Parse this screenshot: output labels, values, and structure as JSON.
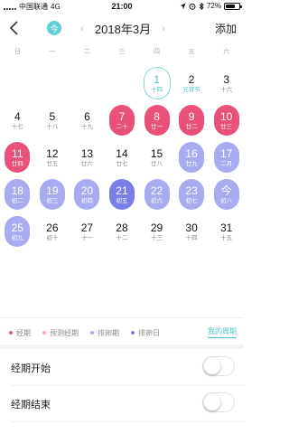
{
  "status_bar": {
    "carrier": "中国联通",
    "network": "4G",
    "time": "21:00",
    "battery": "72%",
    "battery_level": 0.72
  },
  "header": {
    "today_label": "今",
    "month_title": "2018年3月",
    "prev_icon": "chevron-left-icon",
    "next_icon": "chevron-right-icon",
    "add_label": "添加"
  },
  "weekdays": [
    "日",
    "一",
    "二",
    "三",
    "四",
    "五",
    "六"
  ],
  "calendar": {
    "weeks": [
      [
        null,
        null,
        null,
        null,
        {
          "day": "1",
          "sub": "十四",
          "type": "today"
        },
        {
          "day": "2",
          "sub": "元宵节",
          "type": "festival"
        },
        {
          "day": "3",
          "sub": "十六",
          "type": "normal"
        }
      ],
      [
        {
          "day": "4",
          "sub": "十七",
          "type": "normal"
        },
        {
          "day": "5",
          "sub": "十八",
          "type": "normal"
        },
        {
          "day": "6",
          "sub": "十九",
          "type": "normal"
        },
        {
          "day": "7",
          "sub": "二十",
          "type": "period"
        },
        {
          "day": "8",
          "sub": "廿一",
          "type": "period"
        },
        {
          "day": "9",
          "sub": "廿二",
          "type": "period"
        },
        {
          "day": "10",
          "sub": "廿三",
          "type": "period"
        }
      ],
      [
        {
          "day": "11",
          "sub": "廿四",
          "type": "period"
        },
        {
          "day": "12",
          "sub": "廿五",
          "type": "normal"
        },
        {
          "day": "13",
          "sub": "廿六",
          "type": "normal"
        },
        {
          "day": "14",
          "sub": "廿七",
          "type": "normal"
        },
        {
          "day": "15",
          "sub": "廿八",
          "type": "normal"
        },
        {
          "day": "16",
          "sub": "廿九",
          "type": "ovulation"
        },
        {
          "day": "17",
          "sub": "二月",
          "type": "ovulation"
        }
      ],
      [
        {
          "day": "18",
          "sub": "初二",
          "type": "ovulation"
        },
        {
          "day": "19",
          "sub": "初三",
          "type": "ovulation"
        },
        {
          "day": "20",
          "sub": "初四",
          "type": "ovulation"
        },
        {
          "day": "21",
          "sub": "初五",
          "type": "ovulation-day"
        },
        {
          "day": "22",
          "sub": "初六",
          "type": "ovulation"
        },
        {
          "day": "23",
          "sub": "初七",
          "type": "ovulation"
        },
        {
          "day": "今",
          "sub": "初八",
          "type": "ovulation"
        }
      ],
      [
        {
          "day": "25",
          "sub": "初九",
          "type": "ovulation"
        },
        {
          "day": "26",
          "sub": "初十",
          "type": "normal"
        },
        {
          "day": "27",
          "sub": "十一",
          "type": "normal"
        },
        {
          "day": "28",
          "sub": "十二",
          "type": "normal"
        },
        {
          "day": "29",
          "sub": "十三",
          "type": "normal"
        },
        {
          "day": "30",
          "sub": "十四",
          "type": "normal"
        },
        {
          "day": "31",
          "sub": "十五",
          "type": "normal"
        }
      ]
    ]
  },
  "legend": {
    "items": [
      {
        "label": "经期",
        "color": "#e9517a"
      },
      {
        "label": "预测经期",
        "color": "#f6a9bd"
      },
      {
        "label": "排卵期",
        "color": "#a8abf0"
      },
      {
        "label": "排卵日",
        "color": "#7b7de8"
      }
    ],
    "my_cycle_label": "我的周期"
  },
  "settings": [
    {
      "label": "经期开始",
      "on": false
    },
    {
      "label": "经期结束",
      "on": false
    }
  ],
  "colors": {
    "accent": "#52c3c5",
    "period": "#e9517a",
    "ovulation": "#a8abf0",
    "ovulation_day": "#7b7de8"
  }
}
